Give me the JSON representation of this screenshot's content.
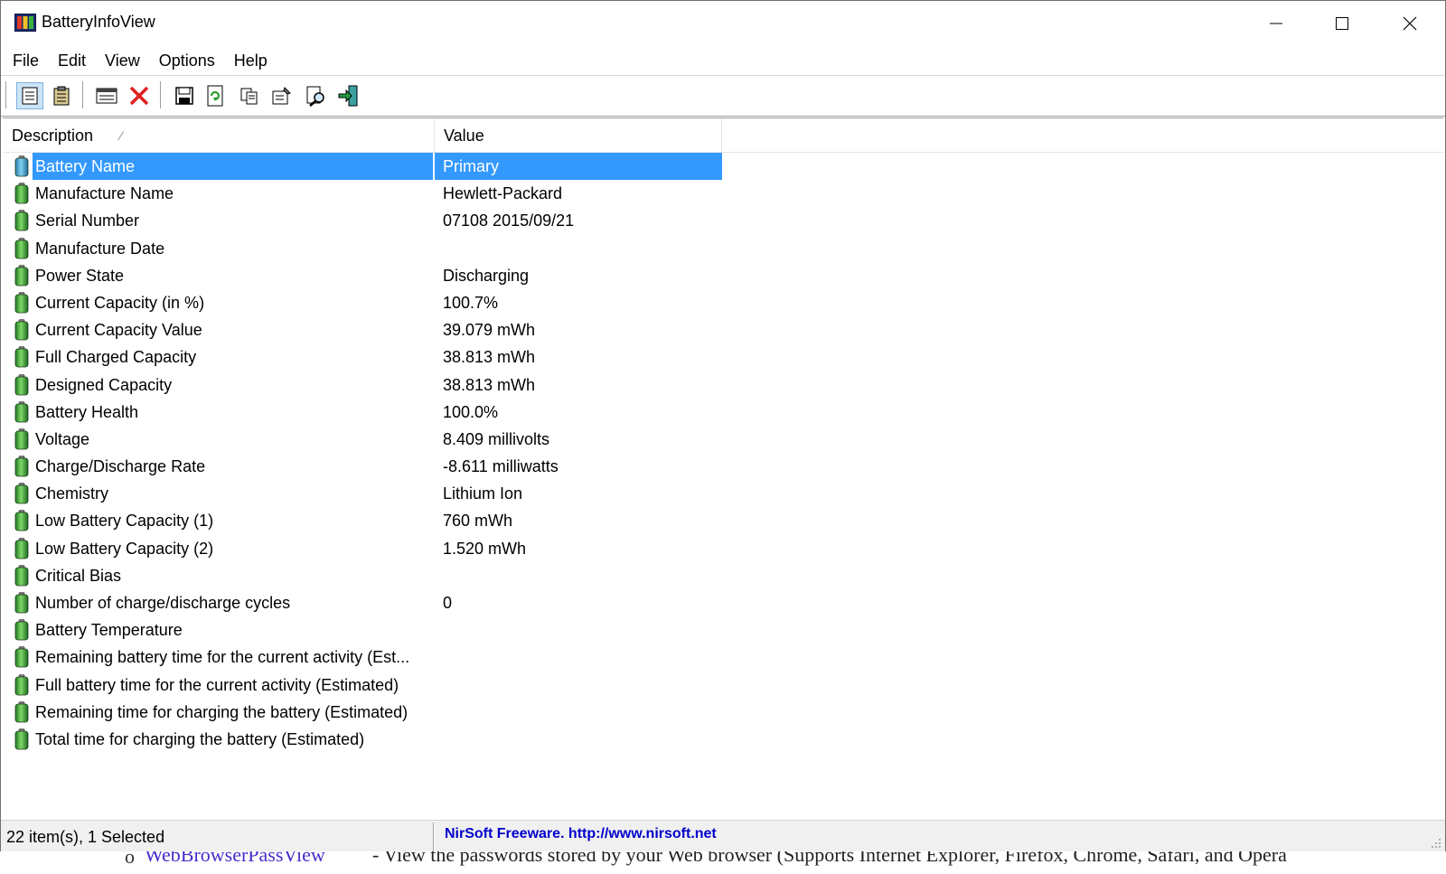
{
  "window": {
    "title": "BatteryInfoView"
  },
  "menu": [
    "File",
    "Edit",
    "View",
    "Options",
    "Help"
  ],
  "toolbar": {
    "buttons": [
      {
        "name": "simple-mode-icon"
      },
      {
        "name": "advanced-mode-icon"
      },
      {
        "name": "battery-log-icon"
      },
      {
        "name": "delete-icon"
      },
      {
        "name": "save-icon"
      },
      {
        "name": "refresh-icon"
      },
      {
        "name": "copy-icon"
      },
      {
        "name": "properties-icon"
      },
      {
        "name": "find-icon"
      },
      {
        "name": "exit-icon"
      }
    ]
  },
  "list": {
    "columns": {
      "description": "Description",
      "value": "Value"
    },
    "rows": [
      {
        "description": "Battery Name",
        "value": "Primary",
        "selected": true
      },
      {
        "description": "Manufacture Name",
        "value": "Hewlett-Packard"
      },
      {
        "description": "Serial Number",
        "value": "07108 2015/09/21"
      },
      {
        "description": "Manufacture Date",
        "value": ""
      },
      {
        "description": "Power State",
        "value": "Discharging"
      },
      {
        "description": "Current Capacity (in %)",
        "value": "100.7%"
      },
      {
        "description": "Current Capacity Value",
        "value": "39.079 mWh"
      },
      {
        "description": "Full Charged Capacity",
        "value": "38.813 mWh"
      },
      {
        "description": "Designed Capacity",
        "value": "38.813 mWh"
      },
      {
        "description": "Battery Health",
        "value": "100.0%"
      },
      {
        "description": "Voltage",
        "value": "8.409 millivolts"
      },
      {
        "description": "Charge/Discharge Rate",
        "value": "-8.611 milliwatts"
      },
      {
        "description": "Chemistry",
        "value": "Lithium Ion"
      },
      {
        "description": "Low Battery Capacity (1)",
        "value": "760 mWh"
      },
      {
        "description": "Low Battery Capacity (2)",
        "value": "1.520 mWh"
      },
      {
        "description": "Critical Bias",
        "value": ""
      },
      {
        "description": "Number of charge/discharge cycles",
        "value": "0"
      },
      {
        "description": "Battery Temperature",
        "value": ""
      },
      {
        "description": "Remaining battery time for the current activity (Est...",
        "value": ""
      },
      {
        "description": "Full battery time for the current activity (Estimated)",
        "value": ""
      },
      {
        "description": "Remaining time for charging the battery (Estimated)",
        "value": ""
      },
      {
        "description": "Total  time for charging the battery (Estimated)",
        "value": ""
      }
    ]
  },
  "status": {
    "count": "22 item(s), 1 Selected",
    "link": "NirSoft Freeware.  http://www.nirsoft.net"
  },
  "background": {
    "bullet": "o",
    "link": "WebBrowserPassView",
    "text": "- View the passwords stored by your Web browser (Supports Internet Explorer, Firefox, Chrome, Safari, and Opera"
  },
  "colors": {
    "selection": "#3399ff",
    "battery_green": "#2e9e2e",
    "link_blue": "#0000cc"
  }
}
